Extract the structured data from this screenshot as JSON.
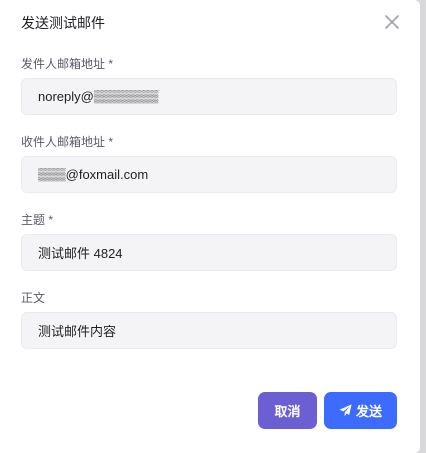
{
  "dialog": {
    "title": "发送测试邮件",
    "close_icon": "close-icon"
  },
  "form": {
    "sender": {
      "label": "发件人邮箱地址 *",
      "value": "noreply@▒▒▒▒▒▒▒"
    },
    "recipient": {
      "label": "收件人邮箱地址 *",
      "value": "▒▒▒@foxmail.com"
    },
    "subject": {
      "label": "主题 *",
      "value": "测试邮件 4824"
    },
    "body": {
      "label": "正文",
      "value": "测试邮件内容"
    }
  },
  "actions": {
    "cancel_label": "取消",
    "send_label": "发送",
    "send_icon": "paper-plane-icon",
    "cancel_color": "#6c5ed3",
    "send_color": "#3d6aff"
  }
}
